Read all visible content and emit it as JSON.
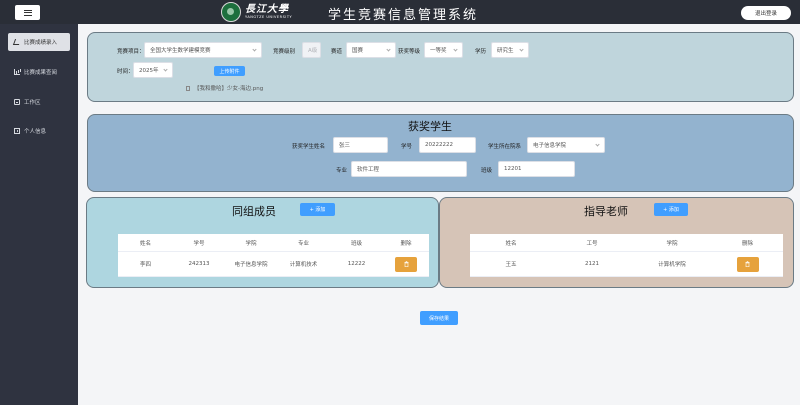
{
  "header": {
    "logo_cn": "長江大學",
    "logo_en": "YANGTZE UNIVERSITY",
    "title": "学生竞赛信息管理系统",
    "logout_label": "退出登录"
  },
  "sidebar": {
    "items": [
      {
        "label": "比赛成绩录入",
        "icon": "pen-icon",
        "active": true
      },
      {
        "label": "比赛成果查阅",
        "icon": "chart-icon",
        "active": false
      },
      {
        "label": "工作区",
        "icon": "workspace-icon",
        "active": false
      },
      {
        "label": "个人信息",
        "icon": "user-icon",
        "active": false
      }
    ]
  },
  "competition": {
    "project_label": "竞赛项目：",
    "project_value": "全国大学生数学建模竞赛",
    "level_label": "竞赛级别",
    "level_value": "A级",
    "track_label": "赛道",
    "track_value": "国赛",
    "award_label": "获奖等级",
    "award_value": "一等奖",
    "education_label": "学历",
    "education_value": "研究生",
    "time_label": "时间：",
    "time_value": "2025年",
    "upload_label": "上传附件",
    "file_name": "【我和撒哈】少女-海边.png"
  },
  "student": {
    "section_title": "获奖学生",
    "name_label": "获奖学生姓名",
    "name_value": "张三",
    "id_label": "学号",
    "id_value": "20222222",
    "college_label": "学生所在院系",
    "college_value": "电子信息学院",
    "major_label": "专业",
    "major_value": "软件工程",
    "class_label": "班级",
    "class_value": "12201"
  },
  "team": {
    "section_title": "同组成员",
    "add_label": "+ 添加",
    "columns": [
      "姓名",
      "学号",
      "学院",
      "专业",
      "班级",
      "删除"
    ],
    "rows": [
      {
        "name": "李四",
        "id": "242313",
        "college": "电子信息学院",
        "major": "计算机技术",
        "class": "12222"
      }
    ]
  },
  "teacher": {
    "section_title": "指导老师",
    "add_label": "+ 添加",
    "columns": [
      "姓名",
      "工号",
      "学院",
      "删除"
    ],
    "rows": [
      {
        "name": "王五",
        "id": "2121",
        "college": "计算机学院"
      }
    ]
  },
  "footer": {
    "save_label": "保存结果"
  },
  "colors": {
    "topbar": "#2a2e37",
    "sidebar": "#2f3340",
    "primary": "#409eff",
    "warning": "#e6a23c",
    "competition_panel": "#bfd5dc",
    "student_panel": "#93b3cf",
    "team_panel": "#aed6e0",
    "teacher_panel": "#d6c4b7"
  }
}
